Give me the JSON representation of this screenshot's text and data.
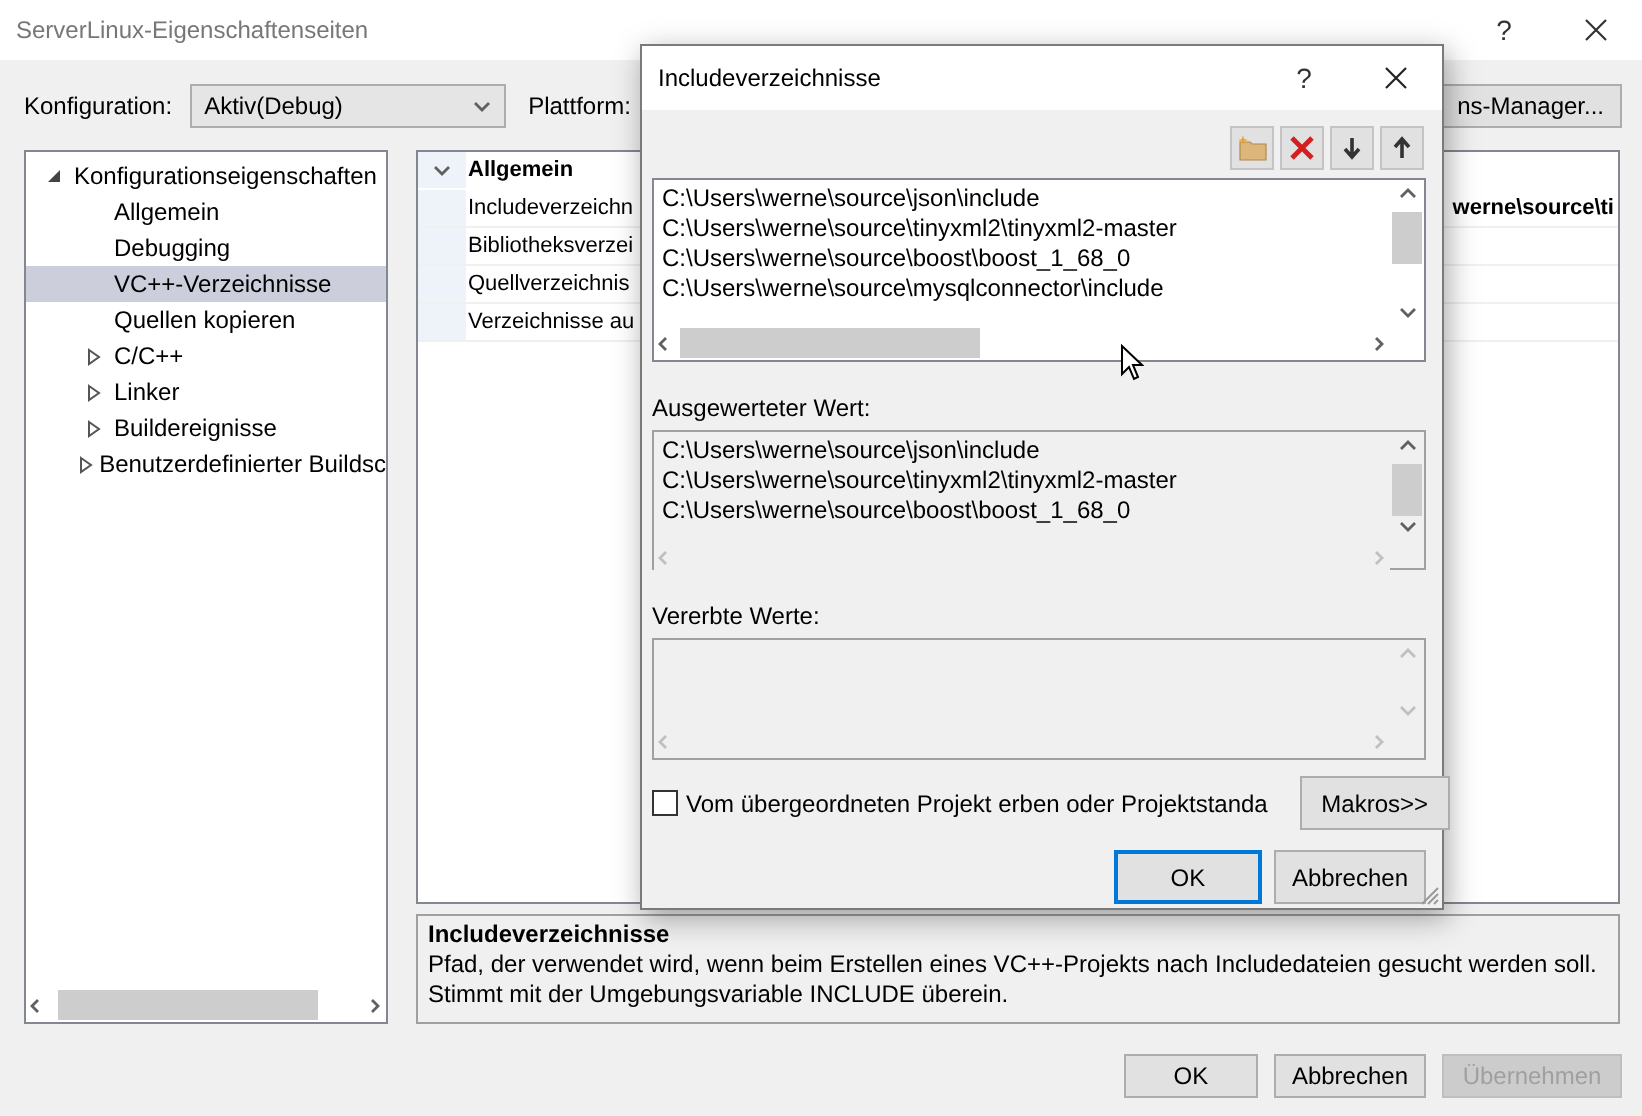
{
  "window": {
    "title": "ServerLinux-Eigenschaftenseiten",
    "help": "?"
  },
  "config": {
    "label": "Konfiguration:",
    "value": "Aktiv(Debug)",
    "platform_label": "Plattform:",
    "manager_button": "ns-Manager..."
  },
  "tree": [
    {
      "label": "Konfigurationseigenschaften",
      "expanded": true,
      "selected": false,
      "children": [
        {
          "label": "Allgemein",
          "selected": false
        },
        {
          "label": "Debugging",
          "selected": false
        },
        {
          "label": "VC++-Verzeichnisse",
          "selected": true
        },
        {
          "label": "Quellen kopieren",
          "selected": false
        },
        {
          "label": "C/C++",
          "expanded": false,
          "selected": false
        },
        {
          "label": "Linker",
          "expanded": false,
          "selected": false
        },
        {
          "label": "Buildereignisse",
          "expanded": false,
          "selected": false
        },
        {
          "label": "Benutzerdefinierter Buildsc",
          "expanded": false,
          "selected": false
        }
      ]
    }
  ],
  "properties": {
    "group": "Allgemein",
    "expanded": true,
    "rows": [
      {
        "name": "Includeverzeichn",
        "value": "werne\\source\\ti"
      },
      {
        "name": "Bibliotheksverzei"
      },
      {
        "name": "Quellverzeichnis"
      },
      {
        "name": "Verzeichnisse au"
      }
    ]
  },
  "description": {
    "title": "Includeverzeichnisse",
    "lines": [
      "Pfad, der verwendet wird, wenn beim Erstellen eines VC++-Projekts nach Includedateien gesucht werden soll.",
      "Stimmt mit der Umgebungsvariable INCLUDE überein."
    ]
  },
  "buttons": [
    {
      "label": "OK",
      "disabled": false
    },
    {
      "label": "Abbrechen",
      "disabled": false
    },
    {
      "label": "Übernehmen",
      "disabled": true
    }
  ],
  "dialog": {
    "title": "Includeverzeichnisse",
    "help": "?",
    "entries": [
      "C:\\Users\\werne\\source\\json\\include",
      "C:\\Users\\werne\\source\\tinyxml2\\tinyxml2-master",
      "C:\\Users\\werne\\source\\boost\\boost_1_68_0",
      "C:\\Users\\werne\\source\\mysqlconnector\\include"
    ],
    "evaluated_label": "Ausgewerteter Wert:",
    "evaluated": [
      "C:\\Users\\werne\\source\\json\\include",
      "C:\\Users\\werne\\source\\tinyxml2\\tinyxml2-master",
      "C:\\Users\\werne\\source\\boost\\boost_1_68_0"
    ],
    "inherited_label": "Vererbte Werte:",
    "inherit_checkbox": {
      "label": "Vom übergeordneten Projekt erben oder Projektstanda",
      "checked": false
    },
    "macros_button": "Makros>>",
    "buttons": [
      {
        "label": "OK",
        "default": true
      },
      {
        "label": "Abbrechen",
        "default": false
      }
    ]
  }
}
